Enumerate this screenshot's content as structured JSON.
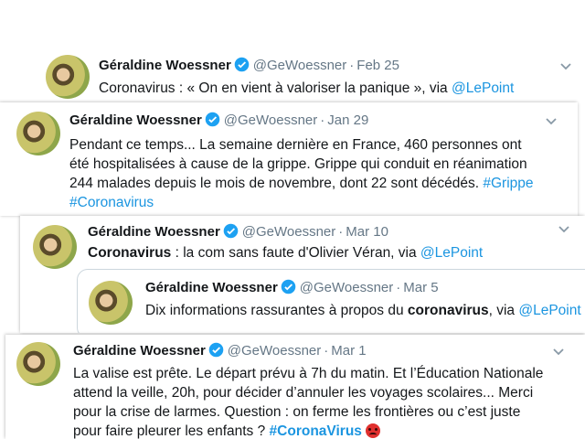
{
  "tweets": [
    {
      "name": "Géraldine Woessner",
      "handle": "@GeWoessner",
      "sep": "·",
      "date": "Feb 25",
      "text_before": "Coronavirus : « On en vient à valoriser la panique », via ",
      "link": "@LePoint"
    },
    {
      "name": "Géraldine Woessner",
      "handle": "@GeWoessner",
      "sep": "·",
      "date": "Jan 29",
      "line1": "Pendant ce temps... La semaine dernière en France, 460 personnes ont",
      "line2": "été hospitalisées à cause de la grippe. Grippe qui conduit en réanimation",
      "line3_text": "244 malades depuis le mois de novembre, dont 22 sont décédés. ",
      "hashtag1": "#Grippe",
      "hashtag2": "#Coronavirus"
    },
    {
      "name": "Géraldine Woessner",
      "handle": "@GeWoessner",
      "sep": "·",
      "date": "Mar 10",
      "bold": "Coronavirus",
      "text_after": " : la com sans faute d'Olivier Véran, via ",
      "link": "@LePoint",
      "quoted": {
        "name": "Géraldine Woessner",
        "handle": "@GeWoessner",
        "sep": "·",
        "date": "Mar 5",
        "text_before": "Dix informations rassurantes à propos du ",
        "bold": "coronavirus",
        "text_after": ", via ",
        "link": "@LePoint"
      }
    },
    {
      "name": "Géraldine Woessner",
      "handle": "@GeWoessner",
      "sep": "·",
      "date": "Mar 1",
      "line1": "La valise est prête. Le départ prévu à 7h du matin. Et l’Éducation Nationale",
      "line2": "attend la veille, 20h, pour décider d’annuler les voyages scolaires... Merci",
      "line3": "pour la crise de larmes. Question : on ferme les frontières ou c’est juste",
      "line4_text": "pour faire pleurer les enfants ? ",
      "hashtag": "#CoronaVirus",
      "emoji_name": "angry-face-icon"
    }
  ],
  "colors": {
    "link": "#1b95e0",
    "muted": "#657786",
    "verified": "#1da1f2"
  }
}
